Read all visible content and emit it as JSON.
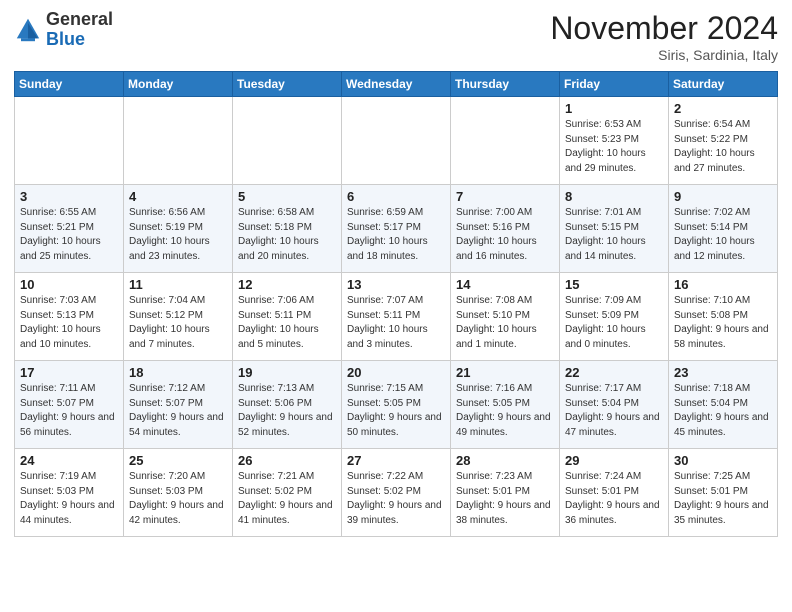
{
  "header": {
    "logo_general": "General",
    "logo_blue": "Blue",
    "month_title": "November 2024",
    "subtitle": "Siris, Sardinia, Italy"
  },
  "weekdays": [
    "Sunday",
    "Monday",
    "Tuesday",
    "Wednesday",
    "Thursday",
    "Friday",
    "Saturday"
  ],
  "weeks": [
    [
      {
        "day": "",
        "info": ""
      },
      {
        "day": "",
        "info": ""
      },
      {
        "day": "",
        "info": ""
      },
      {
        "day": "",
        "info": ""
      },
      {
        "day": "",
        "info": ""
      },
      {
        "day": "1",
        "info": "Sunrise: 6:53 AM\nSunset: 5:23 PM\nDaylight: 10 hours and 29 minutes."
      },
      {
        "day": "2",
        "info": "Sunrise: 6:54 AM\nSunset: 5:22 PM\nDaylight: 10 hours and 27 minutes."
      }
    ],
    [
      {
        "day": "3",
        "info": "Sunrise: 6:55 AM\nSunset: 5:21 PM\nDaylight: 10 hours and 25 minutes."
      },
      {
        "day": "4",
        "info": "Sunrise: 6:56 AM\nSunset: 5:19 PM\nDaylight: 10 hours and 23 minutes."
      },
      {
        "day": "5",
        "info": "Sunrise: 6:58 AM\nSunset: 5:18 PM\nDaylight: 10 hours and 20 minutes."
      },
      {
        "day": "6",
        "info": "Sunrise: 6:59 AM\nSunset: 5:17 PM\nDaylight: 10 hours and 18 minutes."
      },
      {
        "day": "7",
        "info": "Sunrise: 7:00 AM\nSunset: 5:16 PM\nDaylight: 10 hours and 16 minutes."
      },
      {
        "day": "8",
        "info": "Sunrise: 7:01 AM\nSunset: 5:15 PM\nDaylight: 10 hours and 14 minutes."
      },
      {
        "day": "9",
        "info": "Sunrise: 7:02 AM\nSunset: 5:14 PM\nDaylight: 10 hours and 12 minutes."
      }
    ],
    [
      {
        "day": "10",
        "info": "Sunrise: 7:03 AM\nSunset: 5:13 PM\nDaylight: 10 hours and 10 minutes."
      },
      {
        "day": "11",
        "info": "Sunrise: 7:04 AM\nSunset: 5:12 PM\nDaylight: 10 hours and 7 minutes."
      },
      {
        "day": "12",
        "info": "Sunrise: 7:06 AM\nSunset: 5:11 PM\nDaylight: 10 hours and 5 minutes."
      },
      {
        "day": "13",
        "info": "Sunrise: 7:07 AM\nSunset: 5:11 PM\nDaylight: 10 hours and 3 minutes."
      },
      {
        "day": "14",
        "info": "Sunrise: 7:08 AM\nSunset: 5:10 PM\nDaylight: 10 hours and 1 minute."
      },
      {
        "day": "15",
        "info": "Sunrise: 7:09 AM\nSunset: 5:09 PM\nDaylight: 10 hours and 0 minutes."
      },
      {
        "day": "16",
        "info": "Sunrise: 7:10 AM\nSunset: 5:08 PM\nDaylight: 9 hours and 58 minutes."
      }
    ],
    [
      {
        "day": "17",
        "info": "Sunrise: 7:11 AM\nSunset: 5:07 PM\nDaylight: 9 hours and 56 minutes."
      },
      {
        "day": "18",
        "info": "Sunrise: 7:12 AM\nSunset: 5:07 PM\nDaylight: 9 hours and 54 minutes."
      },
      {
        "day": "19",
        "info": "Sunrise: 7:13 AM\nSunset: 5:06 PM\nDaylight: 9 hours and 52 minutes."
      },
      {
        "day": "20",
        "info": "Sunrise: 7:15 AM\nSunset: 5:05 PM\nDaylight: 9 hours and 50 minutes."
      },
      {
        "day": "21",
        "info": "Sunrise: 7:16 AM\nSunset: 5:05 PM\nDaylight: 9 hours and 49 minutes."
      },
      {
        "day": "22",
        "info": "Sunrise: 7:17 AM\nSunset: 5:04 PM\nDaylight: 9 hours and 47 minutes."
      },
      {
        "day": "23",
        "info": "Sunrise: 7:18 AM\nSunset: 5:04 PM\nDaylight: 9 hours and 45 minutes."
      }
    ],
    [
      {
        "day": "24",
        "info": "Sunrise: 7:19 AM\nSunset: 5:03 PM\nDaylight: 9 hours and 44 minutes."
      },
      {
        "day": "25",
        "info": "Sunrise: 7:20 AM\nSunset: 5:03 PM\nDaylight: 9 hours and 42 minutes."
      },
      {
        "day": "26",
        "info": "Sunrise: 7:21 AM\nSunset: 5:02 PM\nDaylight: 9 hours and 41 minutes."
      },
      {
        "day": "27",
        "info": "Sunrise: 7:22 AM\nSunset: 5:02 PM\nDaylight: 9 hours and 39 minutes."
      },
      {
        "day": "28",
        "info": "Sunrise: 7:23 AM\nSunset: 5:01 PM\nDaylight: 9 hours and 38 minutes."
      },
      {
        "day": "29",
        "info": "Sunrise: 7:24 AM\nSunset: 5:01 PM\nDaylight: 9 hours and 36 minutes."
      },
      {
        "day": "30",
        "info": "Sunrise: 7:25 AM\nSunset: 5:01 PM\nDaylight: 9 hours and 35 minutes."
      }
    ]
  ]
}
